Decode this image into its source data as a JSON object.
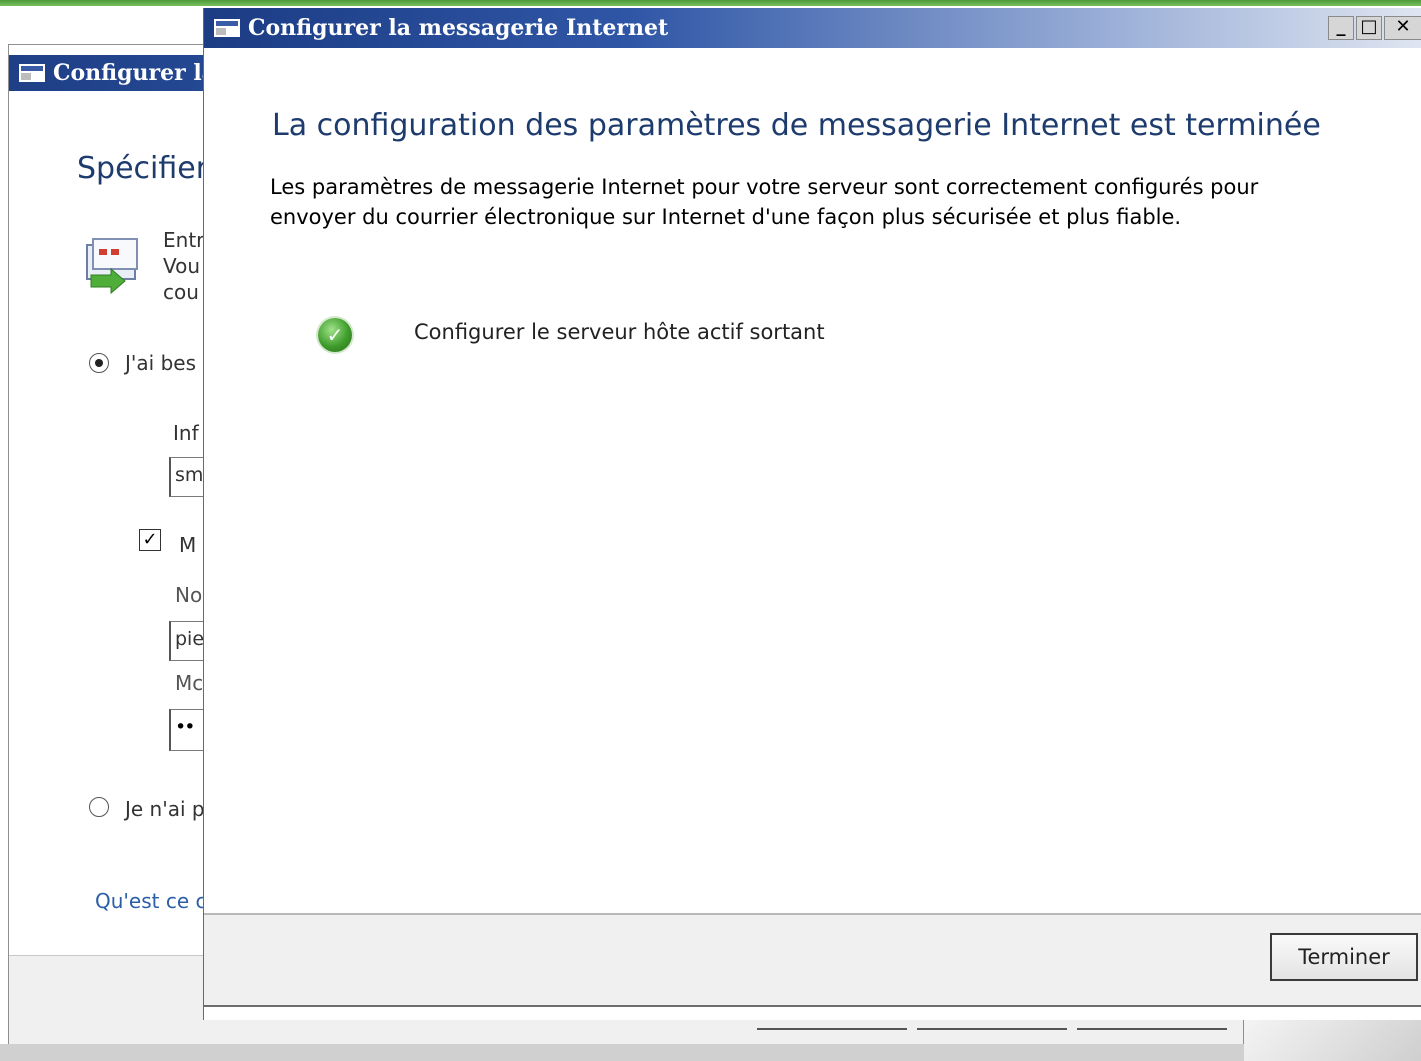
{
  "back_window": {
    "title": "Configurer la",
    "heading": "Spécifier",
    "desc_lines": [
      "Entr",
      "Vou",
      "cou"
    ],
    "radio1_label": "J'ai bes",
    "info_label": "Inf",
    "server_value": "sm",
    "checkbox_label": "M",
    "checkbox_mark": "✓",
    "user_label": "No",
    "user_value": "pie",
    "password_label": "Mc",
    "password_value": "••",
    "radio2_label": "Je n'ai p",
    "help_link": "Qu'est ce c"
  },
  "dialog": {
    "title": "Configurer la messagerie Internet",
    "controls": {
      "minimize": "_",
      "maximize": "□",
      "close": "✕"
    },
    "heading": "La configuration des paramètres de messagerie Internet est terminée",
    "description_line1": "Les paramètres de messagerie Internet pour votre serveur sont correctement configurés pour",
    "description_line2": "envoyer du courrier électronique sur Internet d'une façon plus sécurisée et plus fiable.",
    "steps": [
      {
        "label": "Configurer le serveur hôte actif sortant",
        "status_glyph": "✓",
        "icon": "success-check-icon"
      }
    ],
    "finish_button": "Terminer"
  },
  "colors": {
    "title_bar": "#2c55a5",
    "heading": "#1e3b6e",
    "link": "#2b5ea8",
    "success": "#3f9c2b"
  }
}
